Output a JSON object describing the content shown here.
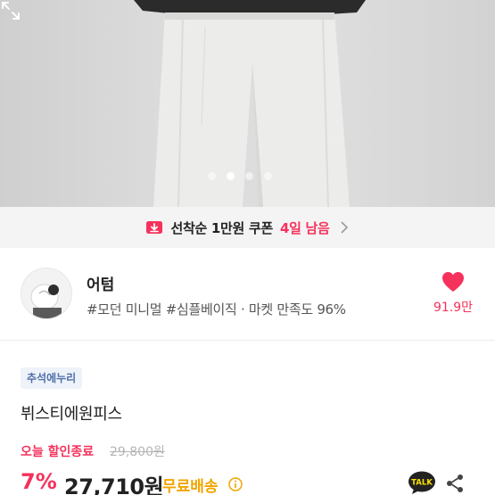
{
  "hero": {
    "slide_count": 4,
    "active_slide": 2
  },
  "coupon": {
    "text": "선착순 1만원 쿠폰",
    "days_left": "4일 남음",
    "icon": "coupon-icon",
    "accent": "#f5325c"
  },
  "shop": {
    "name": "어텀",
    "tags": "#모던 미니멀 #심플베이직 · 마켓 만족도 96%",
    "like_count": "91.9만",
    "like_icon": "heart-icon"
  },
  "product": {
    "badge": "추석에누리",
    "title": "뷔스티에원피스",
    "discount_label": "오늘 할인종료",
    "original_price": "29,800원",
    "discount_rate": "7%",
    "price": "27,710원",
    "shipping": "무료배송"
  },
  "colors": {
    "accent_pink": "#f5325c",
    "shipping_orange": "#f0a500",
    "badge_blue": "#4f6ea8"
  }
}
